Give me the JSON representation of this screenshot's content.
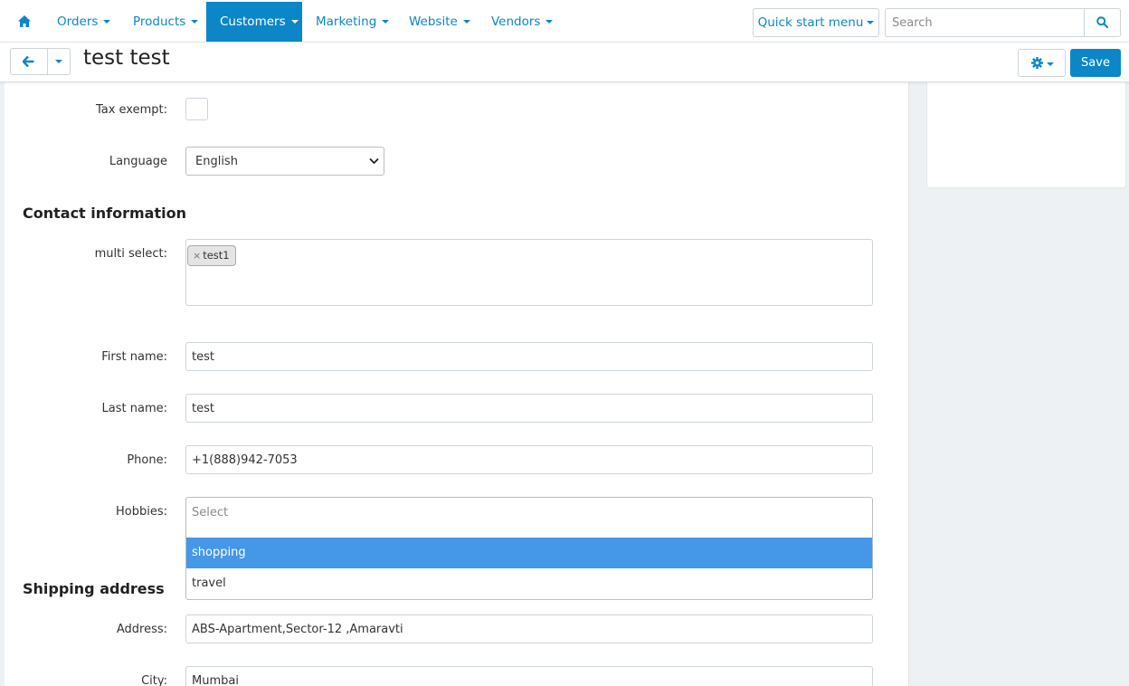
{
  "nav": {
    "items": [
      {
        "label": "Orders"
      },
      {
        "label": "Products"
      },
      {
        "label": "Customers"
      },
      {
        "label": "Marketing"
      },
      {
        "label": "Website"
      },
      {
        "label": "Vendors"
      }
    ],
    "active": "Customers",
    "quick_start_label": "Quick start menu",
    "search_placeholder": "Search"
  },
  "header": {
    "title": "test test",
    "save_label": "Save"
  },
  "form": {
    "tax_exempt_label": "Tax exempt:",
    "tax_exempt_checked": false,
    "language_label": "Language",
    "language_value": "English",
    "contact_section": "Contact information",
    "multi_select_label": "multi select:",
    "multi_select_tags": [
      {
        "label": "test1",
        "remove": "×"
      }
    ],
    "first_name_label": "First name:",
    "first_name_value": "test",
    "last_name_label": "Last name:",
    "last_name_value": "test",
    "phone_label": "Phone:",
    "phone_value": "+1(888)942-7053",
    "hobbies_label": "Hobbies:",
    "hobbies_placeholder": "Select",
    "hobbies_options": [
      {
        "label": "shopping",
        "highlighted": true
      },
      {
        "label": "travel",
        "highlighted": false
      }
    ],
    "shipping_section": "Shipping address",
    "address_label": "Address:",
    "address_value": "ABS-Apartment,Sector-12 ,Amaravti",
    "city_label": "City:",
    "city_value": "Mumbai"
  },
  "colors": {
    "accent": "#0b87c8",
    "highlight": "#4598e8"
  },
  "icons": {
    "home": "home-icon",
    "search": "search-icon",
    "back": "arrow-left-icon",
    "settings": "gear-icon"
  }
}
